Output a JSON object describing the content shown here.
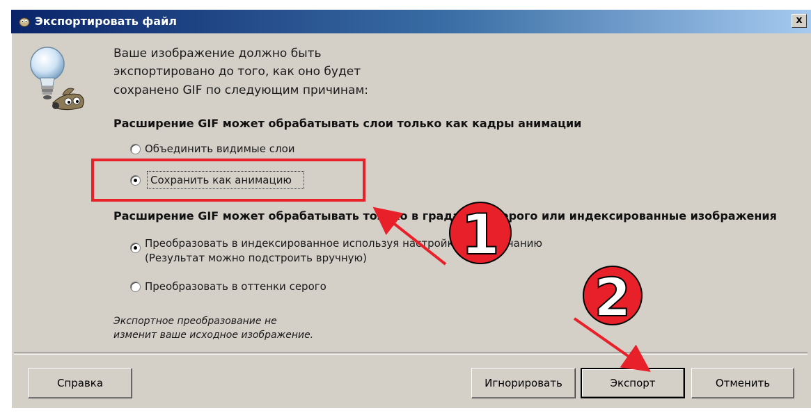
{
  "dialog": {
    "title": "Экспортировать файл",
    "close_label": "x",
    "message_lines": [
      "Ваше изображение должно быть",
      "экспортировано до того, как оно будет",
      "сохранено GIF по следующим причинам:"
    ],
    "section1": {
      "heading": "Расширение GIF может обрабатывать слои только как кадры анимации",
      "options": [
        {
          "label": "Объединить видимые слои",
          "checked": false
        },
        {
          "label": "Сохранить как анимацию",
          "checked": true
        }
      ]
    },
    "section2": {
      "heading": "Расширение GIF может обрабатывать только в градациях серого или индексированные изображения",
      "options": [
        {
          "label": "Преобразовать в индексированное используя настройки по умолчанию",
          "sublabel": "(Результат можно подстроить вручную)",
          "checked": true
        },
        {
          "label": "Преобразовать в оттенки серого",
          "checked": false
        }
      ]
    },
    "note_lines": [
      "Экспортное преобразование не",
      "изменит ваше исходное изображение."
    ],
    "buttons": {
      "help": "Справка",
      "ignore": "Игнорировать",
      "export": "Экспорт",
      "cancel": "Отменить"
    }
  },
  "annotations": {
    "marker1": "1",
    "marker2": "2",
    "annotation_color": "#e8202a"
  },
  "colors": {
    "titlebar_start": "#0a246a",
    "titlebar_end": "#a6caf0",
    "dialog_bg": "#d4d0c8"
  }
}
